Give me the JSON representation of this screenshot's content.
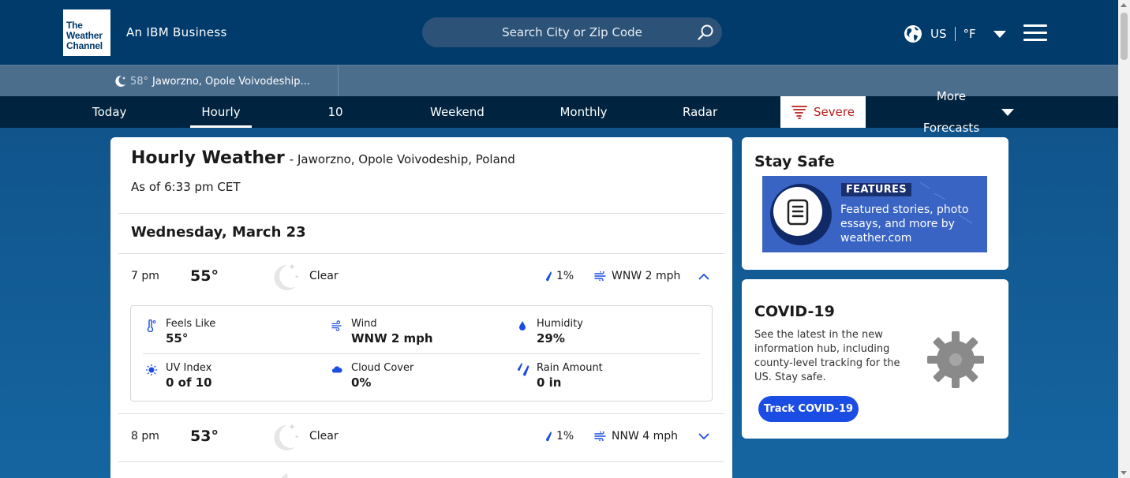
{
  "header": {
    "logo_line1": "The",
    "logo_line2": "Weather",
    "logo_line3": "Channel",
    "tagline": "An IBM Business",
    "search_placeholder": "Search City or Zip Code",
    "country": "US",
    "unit": "°F"
  },
  "strip": {
    "temp": "58°",
    "location": "Jaworzno, Opole Voivodeship..."
  },
  "nav": {
    "items": [
      "Today",
      "Hourly",
      "10 Day",
      "Weekend",
      "Monthly",
      "Radar"
    ],
    "active": "Hourly",
    "severe": "Severe",
    "more": "More Forecasts"
  },
  "main": {
    "title": "Hourly Weather",
    "location": "- Jaworzno, Opole Voivodeship, Poland",
    "as_of": "As of 6:33 pm CET",
    "day": "Wednesday, March 23",
    "rows": [
      {
        "time": "7 pm",
        "temp": "55°",
        "condition": "Clear",
        "precip": "1%",
        "wind": "WNW 2 mph",
        "expanded": true
      },
      {
        "time": "8 pm",
        "temp": "53°",
        "condition": "Clear",
        "precip": "1%",
        "wind": "NNW 4 mph",
        "expanded": false
      }
    ],
    "details": {
      "feels_like_label": "Feels Like",
      "feels_like": "55°",
      "wind_label": "Wind",
      "wind": "WNW 2 mph",
      "humidity_label": "Humidity",
      "humidity": "29%",
      "uv_label": "UV Index",
      "uv": "0 of 10",
      "cloud_label": "Cloud Cover",
      "cloud": "0%",
      "rain_label": "Rain Amount",
      "rain": "0 in"
    }
  },
  "side": {
    "stay_safe_title": "Stay Safe",
    "feature_badge": "FEATURES",
    "feature_text": "Featured stories, photo essays, and more by weather.com",
    "covid_title": "COVID-19",
    "covid_body": "See the latest in the new information hub, including county-level tracking for the US. Stay safe.",
    "covid_button": "Track COVID-19"
  },
  "colors": {
    "header_bg": "#003b6b",
    "nav_bg": "#00233f",
    "severe_red": "#b71c1c",
    "accent_blue": "#1b4de4",
    "page_bg": "#1565a1"
  }
}
